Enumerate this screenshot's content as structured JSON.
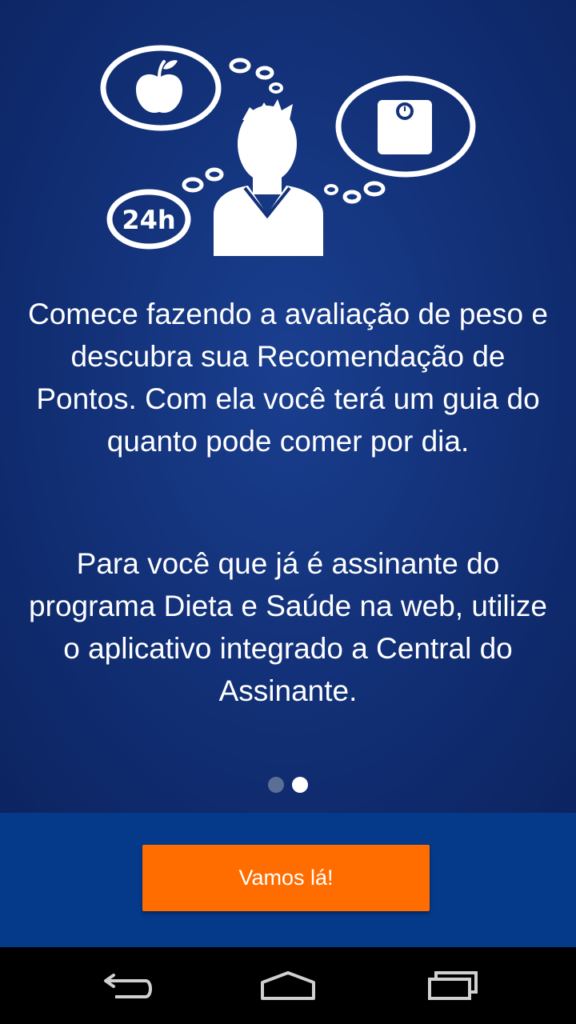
{
  "onboarding": {
    "hero_icons": [
      "apple-icon",
      "weighing-scale-icon",
      "24h-clock-icon",
      "person-icon",
      "thought-bubble-icon"
    ],
    "hero_badge_24h": "24h",
    "paragraph_1": "Comece fazendo a avaliação de peso e descubra sua Recomendação de Pontos. Com ela você terá um guia do quanto pode comer por dia.",
    "paragraph_2": "Para você que já é assinante do programa Dieta e Saúde na web, utilize o aplicativo integrado a Central do Assinante.",
    "pager": {
      "total": 2,
      "current": 2
    }
  },
  "footer": {
    "button_label": "Vamos lá!"
  },
  "navbar": {
    "icons": [
      "back-icon",
      "home-icon",
      "recents-icon"
    ]
  },
  "colors": {
    "background": "#13327a",
    "footer": "#053a8a",
    "button": "#ff6d00"
  }
}
